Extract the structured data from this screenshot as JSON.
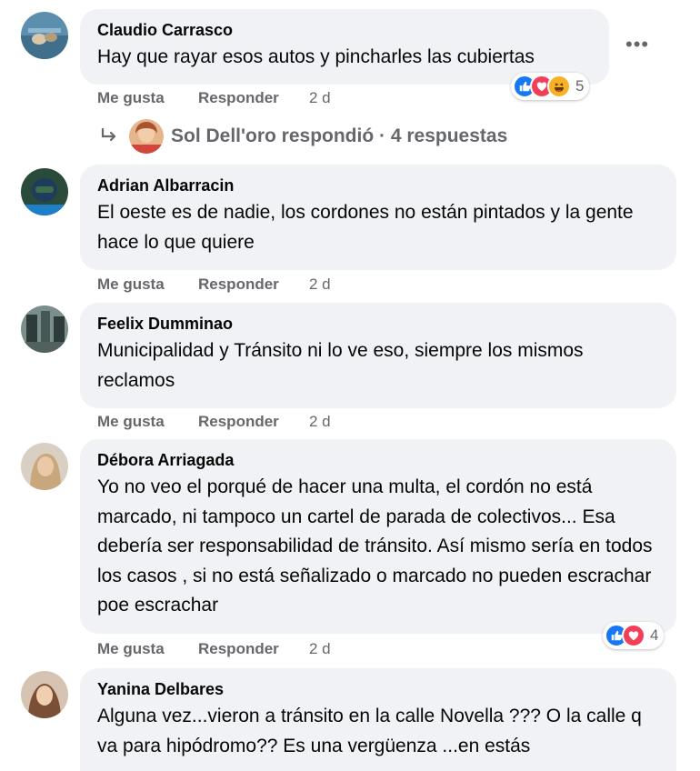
{
  "comments": [
    {
      "author": "Claudio Carrasco",
      "text": "Hay que rayar esos autos y pincharles las cubiertas",
      "like": "Me gusta",
      "reply": "Responder",
      "time": "2 d",
      "reaction_count": "5",
      "reactions": [
        "like",
        "love",
        "haha"
      ],
      "replies": {
        "text": "Sol Dell'oro respondió · 4 respuestas"
      }
    },
    {
      "author": "Adrian Albarracin",
      "text": "El oeste es de nadie, los cordones no están pintados y la gente hace lo que quiere",
      "like": "Me gusta",
      "reply": "Responder",
      "time": "2 d"
    },
    {
      "author": "Feelix Dumminao",
      "text": "Municipalidad y Tránsito ni lo ve eso, siempre los mismos reclamos",
      "like": "Me gusta",
      "reply": "Responder",
      "time": "2 d"
    },
    {
      "author": "Débora Arriagada",
      "text": "Yo no veo el porqué de hacer una multa, el cordón no está marcado, ni tampoco un cartel de parada de colectivos... Esa debería ser responsabilidad de tránsito. Así mismo sería en todos los casos , si no está señalizado o marcado no pueden escrachar poe escrachar",
      "like": "Me gusta",
      "reply": "Responder",
      "time": "2 d",
      "reaction_count": "4",
      "reactions": [
        "like",
        "love"
      ]
    },
    {
      "author": "Yanina Delbares",
      "text": "Alguna vez...vieron a tránsito en la calle Novella ??? O la calle q va para hipódromo?? Es una vergüenza ...en estás"
    }
  ],
  "colors": {
    "like": "#1877f2",
    "love": "#f33e58",
    "haha": "#f7b125",
    "bubble": "#f0f2f5",
    "meta": "#65676b"
  },
  "icons": {
    "more": "more-horizontal-icon",
    "reply_arrow": "reply-arrow-icon"
  }
}
